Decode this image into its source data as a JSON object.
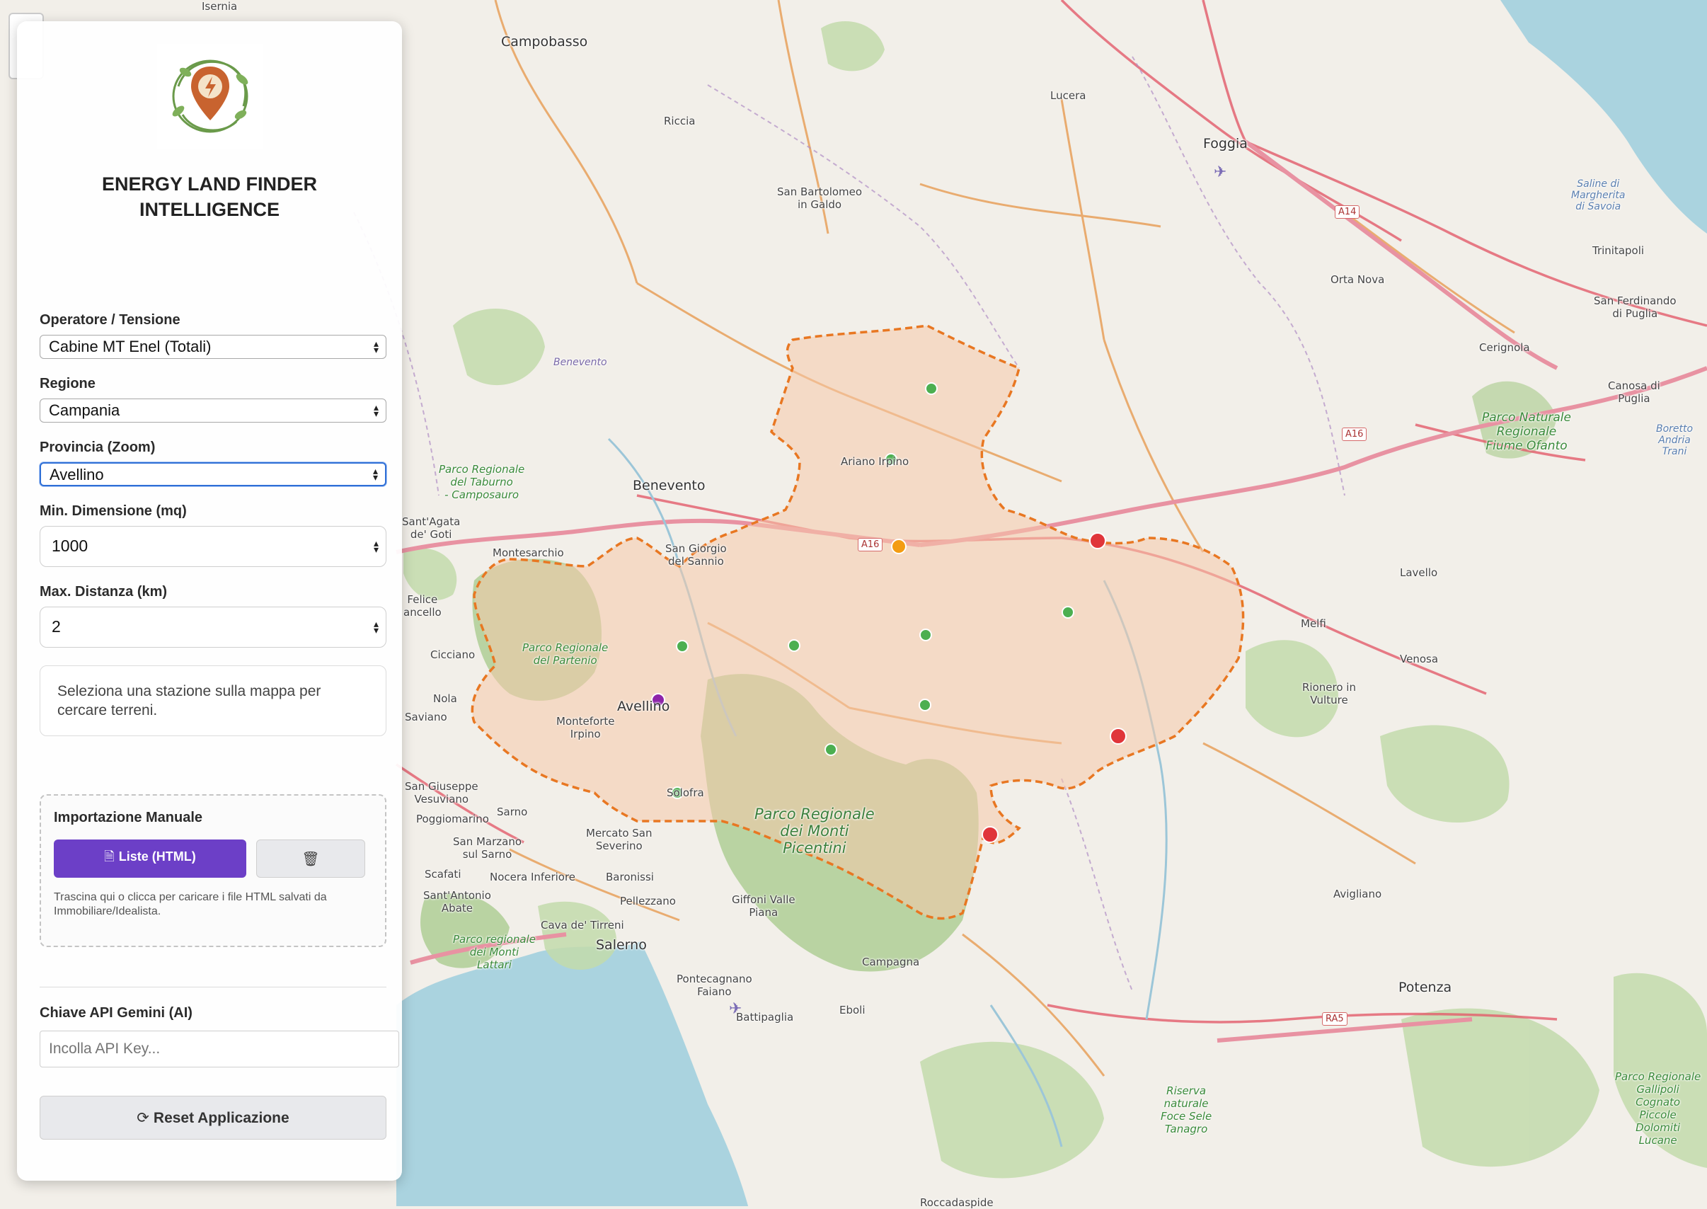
{
  "app": {
    "title": "ENERGY LAND FINDER\nINTELLIGENCE",
    "logo_icon": "lightning-pin-logo"
  },
  "form": {
    "operator": {
      "label": "Operatore / Tensione",
      "value": "Cabine MT Enel (Totali)"
    },
    "region": {
      "label": "Regione",
      "value": "Campania"
    },
    "province": {
      "label": "Provincia (Zoom)",
      "value": "Avellino"
    },
    "min_size": {
      "label": "Min. Dimensione (mq)",
      "value": "1000"
    },
    "max_distance": {
      "label": "Max. Distanza (km)",
      "value": "2"
    }
  },
  "info_message": "Seleziona una stazione sulla mappa per cercare terreni.",
  "import": {
    "title": "Importazione Manuale",
    "upload_label": "Liste (HTML)",
    "upload_icon": "file-upload-icon",
    "delete_icon": "trash-icon",
    "help": "Trascina qui o clicca per caricare i file HTML salvati da Immobiliare/Idealista."
  },
  "api_key": {
    "label": "Chiave API Gemini (AI)",
    "placeholder": "Incolla API Key..."
  },
  "reset": {
    "label": "Reset Applicazione",
    "icon": "refresh-icon"
  },
  "colors": {
    "accent_purple": "#6c3fc7",
    "province_fill": "#f6c9a9",
    "province_border": "#e87722",
    "marker_green": "#4caf50",
    "marker_red": "#e0353a",
    "marker_orange": "#f39c12",
    "marker_purple": "#8e24aa"
  },
  "map": {
    "place_labels": [
      "Isernia",
      "Campobasso",
      "Lucera",
      "Foggia",
      "Riccia",
      "San Bartolomeo\nin Galdo",
      "Trinitapoli",
      "Orta Nova",
      "San Ferdinando\ndi Puglia",
      "Cerignola",
      "Canosa di\nPuglia",
      "Benevento",
      "Ariano Irpino",
      "San Giorgio\ndel Sannio",
      "Montesarchio",
      "Avellino",
      "Monteforte\nIrpino",
      "Solofra",
      "Mercato San\nSeverino",
      "Baronissi",
      "Pellezzano",
      "Giffoni Valle\nPiana",
      "Campagna",
      "Salerno",
      "Cava de' Tirreni",
      "Nocera Inferiore",
      "Sarno",
      "San Marzano\nsul Sarno",
      "Scafati",
      "Sant'Antonio\nAbate",
      "Pontecagnano\nFaiano",
      "Battipaglia",
      "Eboli",
      "Lavello",
      "Melfi",
      "Venosa",
      "Rionero in\nVulture",
      "Avigliano",
      "Potenza",
      "Saviano",
      "Nola",
      "Cicciano",
      "Felice\nancello",
      "Sant'Agata\nde' Goti",
      "Poggiomarino",
      "San Giuseppe\nVesuviano",
      "Roccadaspide"
    ],
    "park_labels": [
      "Parco Regionale\ndel Taburno\n- Camposauro",
      "Parco Regionale\ndel Partenio",
      "Parco Regionale\ndei Monti\nPicentini",
      "Parco Naturale\nRegionale\nFiume Ofanto",
      "Parco regionale\ndei Monti\nLattari",
      "Riserva\nnaturale\nFoce Sele\nTanagro",
      "Parco Regionale\nGallipoli\nCognato\nPiccole\nDolomiti\nLucane"
    ],
    "water_labels": [
      "Saline di\nMargherita\ndi Savoia",
      "Boretto\nAndria\nTrani",
      "Benevento"
    ],
    "road_shields": [
      "A16",
      "A14",
      "A16",
      "RA5"
    ]
  }
}
